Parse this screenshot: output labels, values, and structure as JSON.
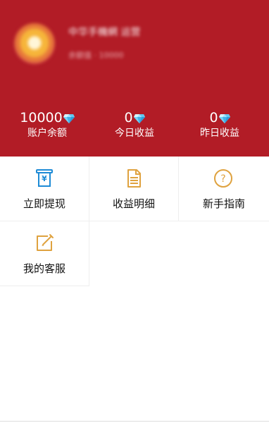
{
  "profile": {
    "name": "中华手機網 运营",
    "sub": "余额值 · 10000"
  },
  "stats": [
    {
      "value": "10000",
      "label": "账户余额",
      "icon": "diamond-icon"
    },
    {
      "value": "0",
      "label": "今日收益",
      "icon": "diamond-icon"
    },
    {
      "value": "0",
      "label": "昨日收益",
      "icon": "diamond-icon"
    }
  ],
  "menu": [
    {
      "label": "立即提现",
      "icon": "withdraw-icon"
    },
    {
      "label": "收益明细",
      "icon": "document-icon"
    },
    {
      "label": "新手指南",
      "icon": "question-icon"
    },
    {
      "label": "我的客服",
      "icon": "edit-icon"
    }
  ],
  "colors": {
    "header": "#b21c26",
    "accent_blue": "#1e8bd6",
    "accent_gold": "#dfa23f",
    "diamond": "#54b7ea"
  }
}
